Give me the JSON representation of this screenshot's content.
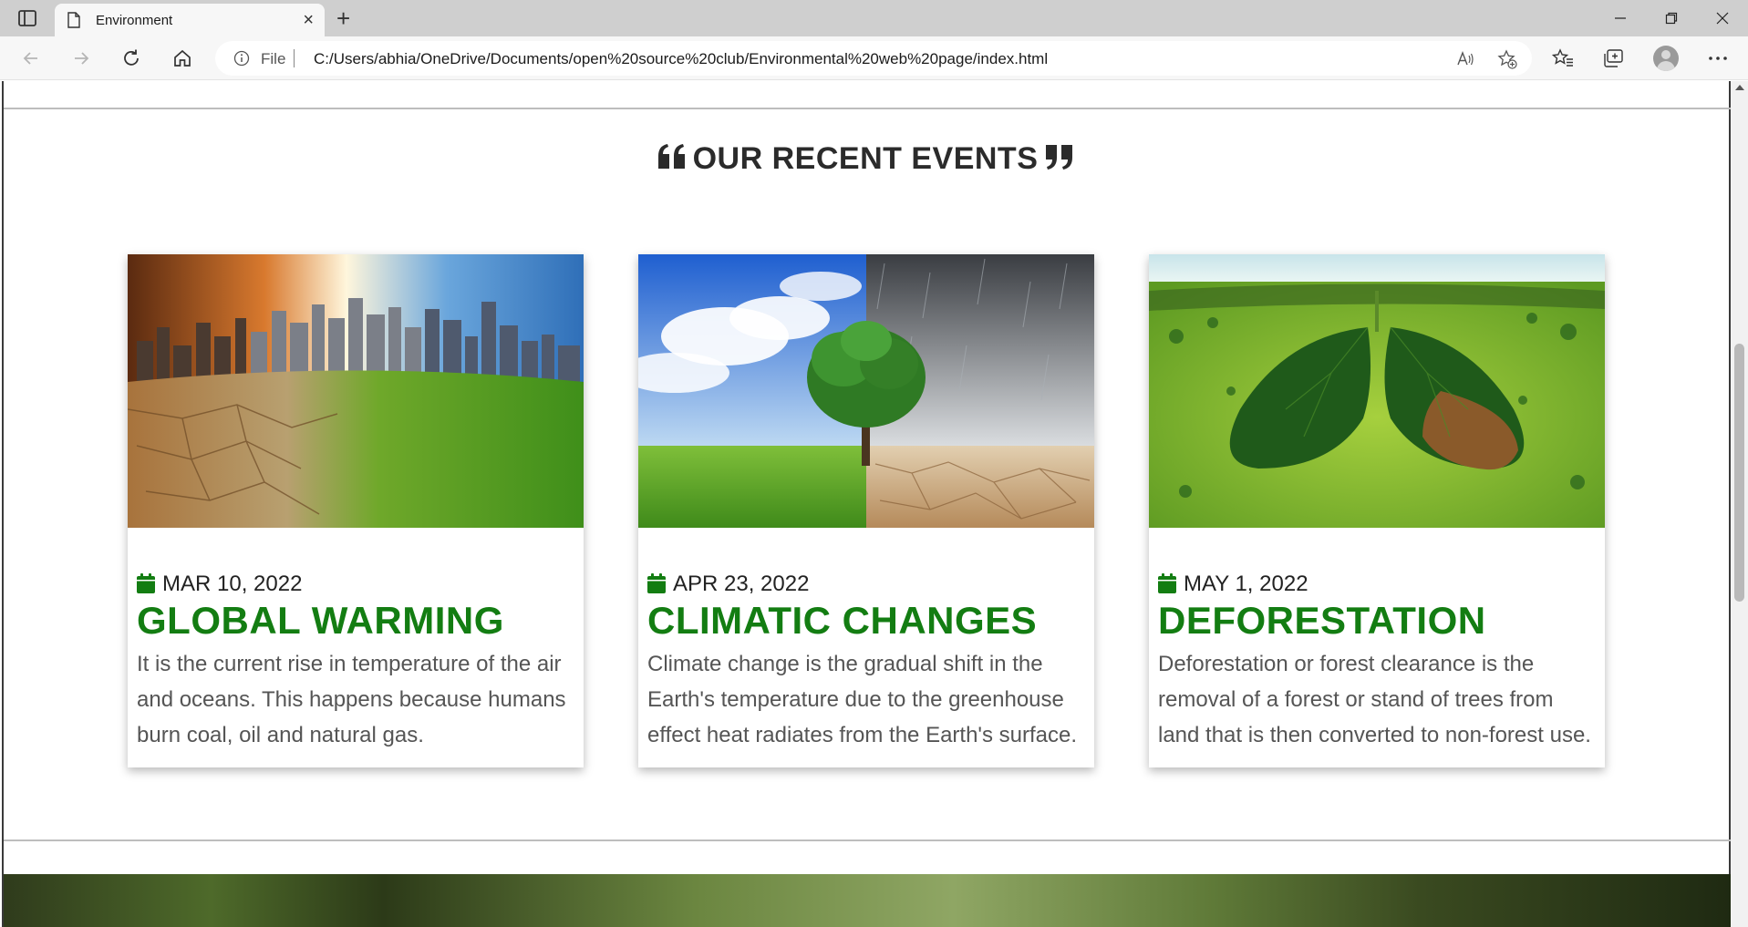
{
  "browser": {
    "tab_title": "Environment",
    "address_prefix": "File",
    "url": "C:/Users/abhia/OneDrive/Documents/open%20source%20club/Environmental%20web%20page/index.html"
  },
  "section": {
    "title": "OUR RECENT EVENTS"
  },
  "events": [
    {
      "date": "MAR 10, 2022",
      "title": "GLOBAL WARMING",
      "text": "It is the current rise in temperature of the air and oceans. This happens because humans burn coal, oil and natural gas."
    },
    {
      "date": "APR 23, 2022",
      "title": "CLIMATIC CHANGES",
      "text": "Climate change is the gradual shift in the Earth's temperature due to the greenhouse effect heat radiates from the Earth's surface."
    },
    {
      "date": "MAY 1, 2022",
      "title": "DEFORESTATION",
      "text": "Deforestation or forest clearance is the removal of a forest or stand of trees from land that is then converted to non-forest use."
    }
  ],
  "colors": {
    "accent_green": "#137d12",
    "heading": "#2b2b2b",
    "body_text": "#555555"
  },
  "icons": {
    "date": "calendar-icon",
    "quote_open": "quote-left-icon",
    "quote_close": "quote-right-icon"
  }
}
